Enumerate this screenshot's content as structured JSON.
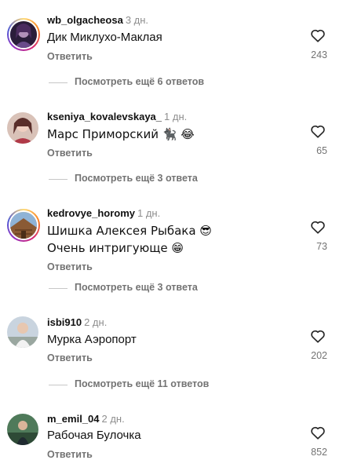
{
  "comments": [
    {
      "username": "wb_olgacheosa",
      "time": "3 дн.",
      "text": "Дик Миклухо-Маклая",
      "reply_label": "Ответить",
      "likes": "243",
      "more_replies": "Посмотреть ещё 6 ответов"
    },
    {
      "username": "kseniya_kovalevskaya_",
      "time": "1 дн.",
      "text": "Марс Приморский 🐈‍⬛ 😂",
      "reply_label": "Ответить",
      "likes": "65",
      "more_replies": "Посмотреть ещё 3 ответа"
    },
    {
      "username": "kedrovye_horomy",
      "time": "1 дн.",
      "text": "Шишка Алексея Рыбака 😎 Очень интригующе 😁",
      "reply_label": "Ответить",
      "likes": "73",
      "more_replies": "Посмотреть ещё 3 ответа"
    },
    {
      "username": "isbi910",
      "time": "2 дн.",
      "text": "Мурка Аэропорт",
      "reply_label": "Ответить",
      "likes": "202",
      "more_replies": "Посмотреть ещё 11 ответов"
    },
    {
      "username": "m_emil_04",
      "time": "2 дн.",
      "text": "Рабочая Булочка",
      "reply_label": "Ответить",
      "likes": "852"
    }
  ],
  "icons": {
    "like": "heart-outline-icon"
  },
  "colors": {
    "secondary_text": "#737373",
    "divider": "#c7c7c7"
  }
}
